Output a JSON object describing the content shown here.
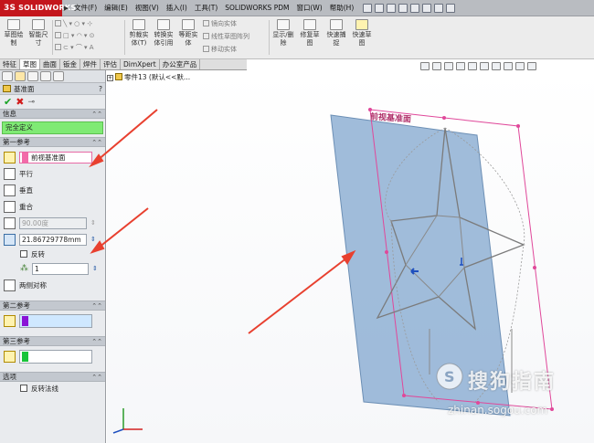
{
  "app": {
    "logo_text": "SOLIDWORKS",
    "logo_mark": "3S"
  },
  "menu": [
    "文件(F)",
    "编辑(E)",
    "视图(V)",
    "插入(I)",
    "工具(T)",
    "SOLIDWORKS PDM",
    "窗口(W)",
    "帮助(H)"
  ],
  "ribbon": {
    "sketch": "草图绘制",
    "smart_dim": "智能尺寸",
    "trim": "剪裁实体(T)",
    "convert": "转换实体引用",
    "offset": "等距实体",
    "mirror": "镜向实体",
    "linear_pattern": "线性草图阵列",
    "move": "移动实体",
    "display": "显示/删除",
    "repair": "修复草图",
    "quick_snap": "快速捕捉",
    "rapid_sketch": "快速草图"
  },
  "cmd_tabs": [
    "特征",
    "草图",
    "曲面",
    "钣金",
    "焊件",
    "评估",
    "DimXpert",
    "办公室产品"
  ],
  "tree_root": "零件13 (默认<<默...",
  "panel": {
    "title": "基准面",
    "help": "?",
    "message_header": "信息",
    "message": "完全定义",
    "first_ref": {
      "header": "第一参考",
      "selection": "前视基准面",
      "options": [
        "平行",
        "垂直",
        "重合"
      ],
      "angle": "90.00度",
      "distance": "21.86729778mm",
      "flip_label": "反转",
      "count": "1",
      "symmetric_label": "两侧对称"
    },
    "second_ref": {
      "header": "第二参考"
    },
    "third_ref": {
      "header": "第三参考"
    },
    "options": {
      "header": "选项",
      "flip_normal": "反转法线"
    }
  },
  "viewport": {
    "plane_label": "前视基准面"
  },
  "watermark": {
    "main": "搜狗指南",
    "sub": "zhinan.sogou.com",
    "mark": "S"
  },
  "colors": {
    "accent_red": "#c4161c",
    "plane_fill": "#8fb0d4",
    "plane_preview": "#e0489a",
    "msg_green": "#7fea74",
    "arrow_red": "#e8402f"
  }
}
